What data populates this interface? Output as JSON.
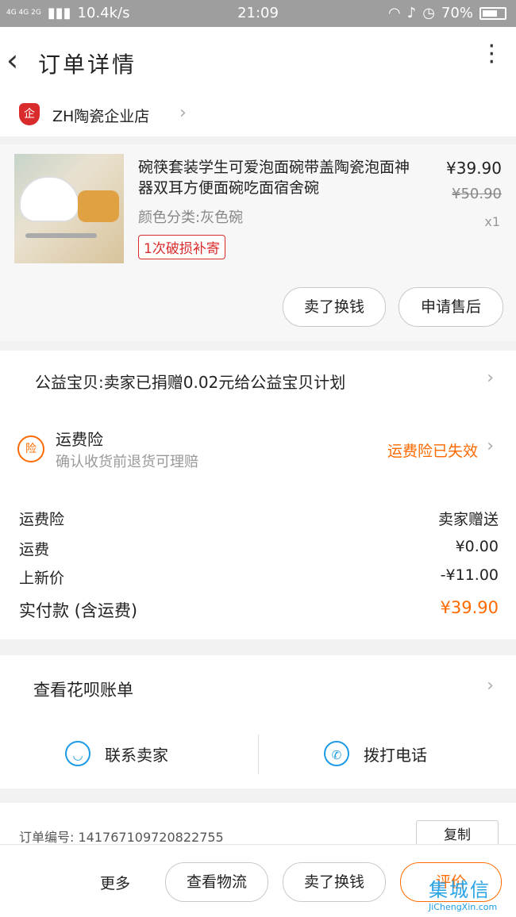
{
  "status": {
    "network": "4G 4G 2G",
    "speed": "10.4k/s",
    "time": "21:09",
    "battery": "70%"
  },
  "header": {
    "title": "订单详情"
  },
  "shop": {
    "name": "ZH陶瓷企业店",
    "logo_text": "企"
  },
  "product": {
    "title": "碗筷套装学生可爱泡面碗带盖陶瓷泡面神器双耳方便面碗吃面宿舍碗",
    "sku": "颜色分类:灰色碗",
    "tag": "1次破损补寄",
    "price": "¥39.90",
    "original_price": "¥50.90",
    "quantity": "x1",
    "buttons": [
      "卖了换钱",
      "申请售后"
    ]
  },
  "charity": {
    "text": "公益宝贝:卖家已捐赠0.02元给公益宝贝计划"
  },
  "insurance": {
    "badge": "险",
    "title": "运费险",
    "subtitle": "确认收货前退货可理赔",
    "status": "运费险已失效"
  },
  "fees": [
    {
      "label": "运费险",
      "value": "卖家赠送"
    },
    {
      "label": "运费",
      "value": "¥0.00"
    },
    {
      "label": "上新价",
      "value": "-¥11.00"
    },
    {
      "label": "实付款 (含运费)",
      "value": "¥39.90"
    }
  ],
  "huabei": {
    "text": "查看花呗账单"
  },
  "contact": {
    "seller": "联系卖家",
    "call": "拨打电话"
  },
  "order": {
    "number_label": "订单编号:",
    "number": "141767109720822755",
    "copy": "复制"
  },
  "bottom": {
    "more": "更多",
    "logistics": "查看物流",
    "resell": "卖了换钱",
    "review": "评价"
  },
  "watermark": {
    "brand": "集城信",
    "site": "JiChengXin.com"
  },
  "colors": {
    "accent": "#ff6a00",
    "blue": "#1c9be6",
    "red": "#d92b2b"
  }
}
